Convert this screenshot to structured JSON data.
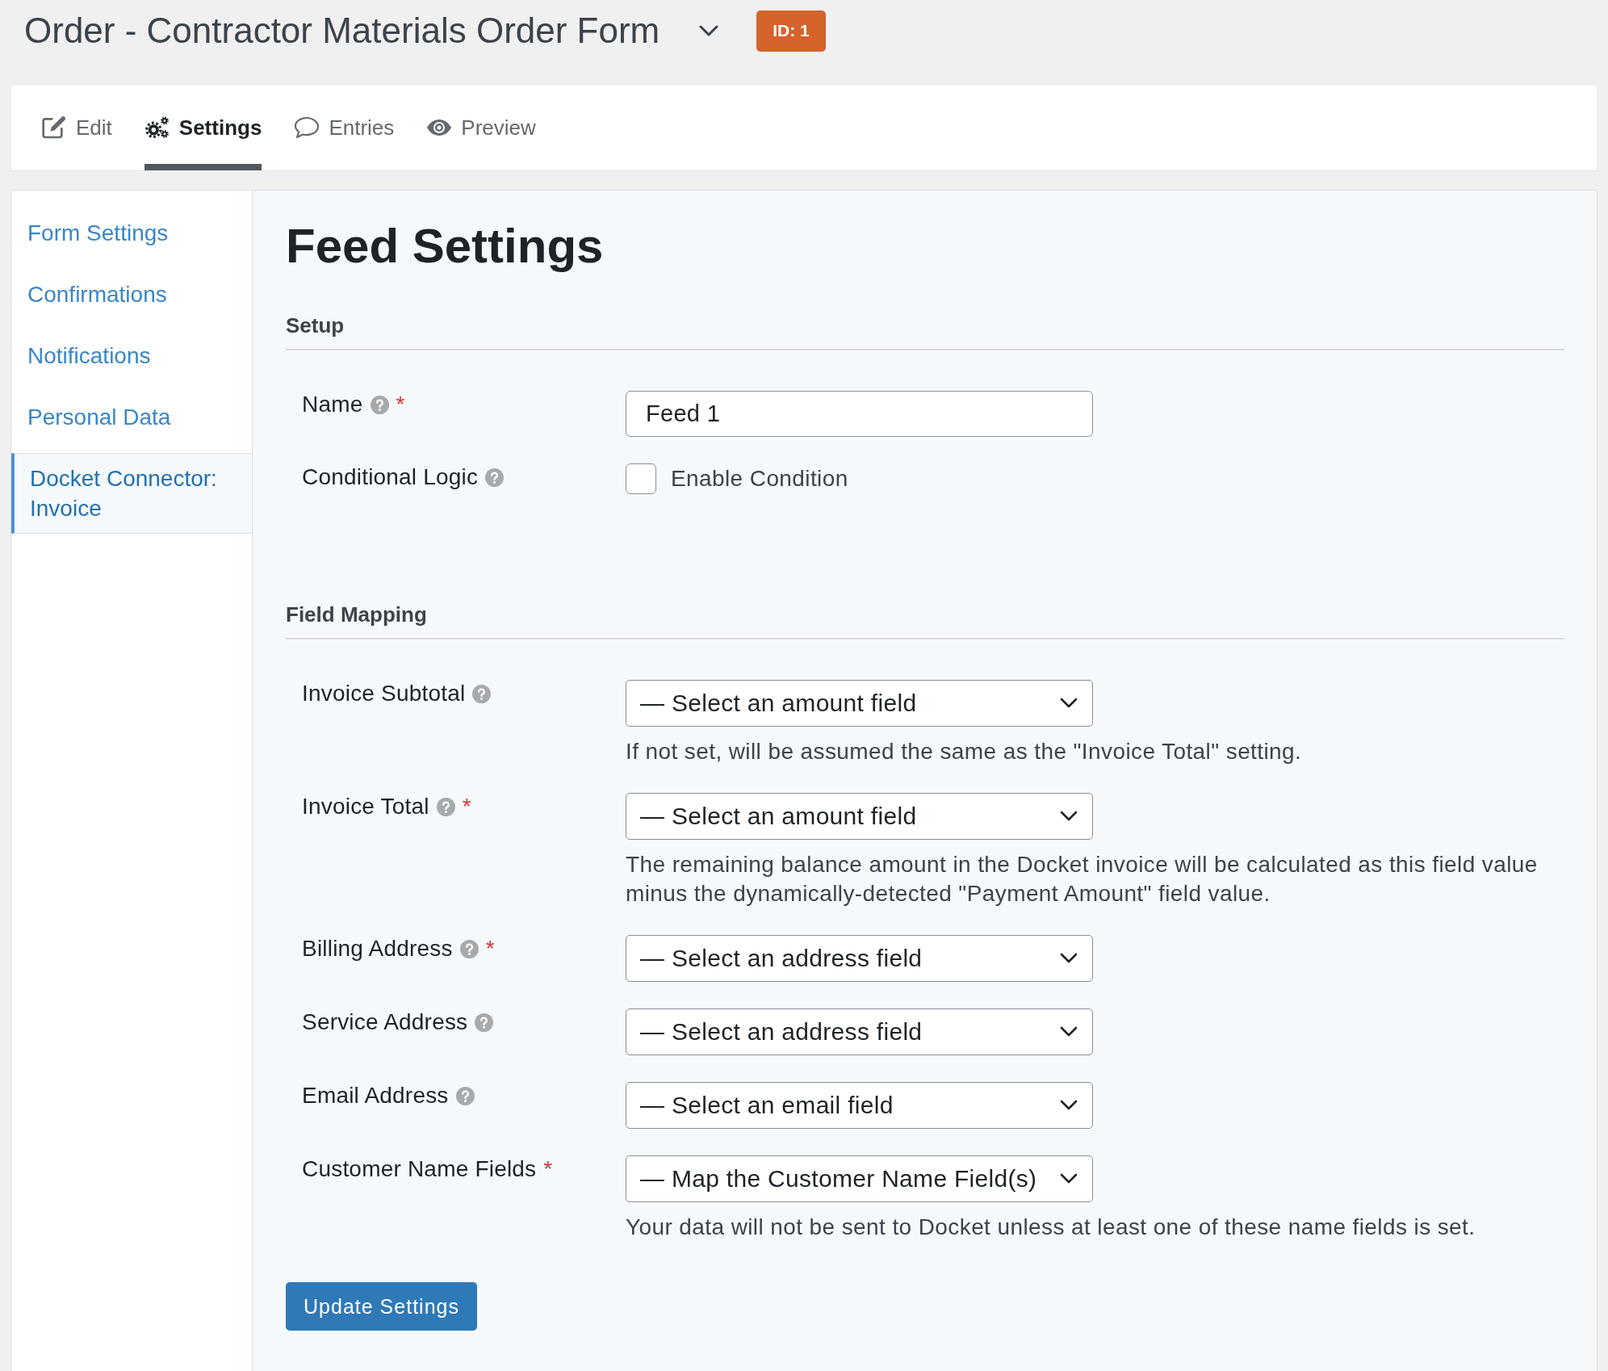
{
  "header": {
    "title": "Order - Contractor Materials Order Form",
    "id_badge": "ID: 1"
  },
  "tabs": [
    {
      "label": "Edit",
      "selected": false
    },
    {
      "label": "Settings",
      "selected": true
    },
    {
      "label": "Entries",
      "selected": false
    },
    {
      "label": "Preview",
      "selected": false
    }
  ],
  "sidebar": {
    "items": [
      {
        "label": "Form Settings",
        "selected": false
      },
      {
        "label": "Confirmations",
        "selected": false
      },
      {
        "label": "Notifications",
        "selected": false
      },
      {
        "label": "Personal Data",
        "selected": false
      },
      {
        "label": "Docket Connector: Invoice",
        "selected": true
      }
    ]
  },
  "page": {
    "heading": "Feed Settings",
    "sections": [
      {
        "title": "Setup",
        "fields": [
          {
            "kind": "text",
            "label": "Name",
            "help_icon": true,
            "required_mark": "*",
            "value": "Feed 1"
          },
          {
            "kind": "checkbox",
            "label": "Conditional Logic",
            "help_icon": true,
            "option": "Enable Condition",
            "checked": false
          }
        ]
      },
      {
        "title": "Field Mapping",
        "fields": [
          {
            "kind": "select",
            "label": "Invoice Subtotal",
            "help_icon": true,
            "value": "— Select an amount field",
            "description": "If not set, will be assumed the same as the \"Invoice Total\" setting."
          },
          {
            "kind": "select",
            "label": "Invoice Total",
            "help_icon": true,
            "required_mark": "*",
            "value": "— Select an amount field",
            "description": "The remaining balance amount in the Docket invoice will be calculated as this field value minus the dynamically-detected \"Payment Amount\" field value."
          },
          {
            "kind": "select",
            "label": "Billing Address",
            "help_icon": true,
            "required_mark": "*",
            "value": "— Select an address field"
          },
          {
            "kind": "select",
            "label": "Service Address",
            "help_icon": true,
            "value": "— Select an address field"
          },
          {
            "kind": "select",
            "label": "Email Address",
            "help_icon": true,
            "value": "— Select an email field"
          },
          {
            "kind": "select",
            "label": "Customer Name Fields",
            "help_icon": false,
            "required_mark": "*",
            "value": "— Map the Customer Name Field(s)",
            "description": "Your data will not be sent to Docket unless at least one of these name fields is set."
          }
        ]
      }
    ],
    "submit_button": "Update Settings"
  }
}
